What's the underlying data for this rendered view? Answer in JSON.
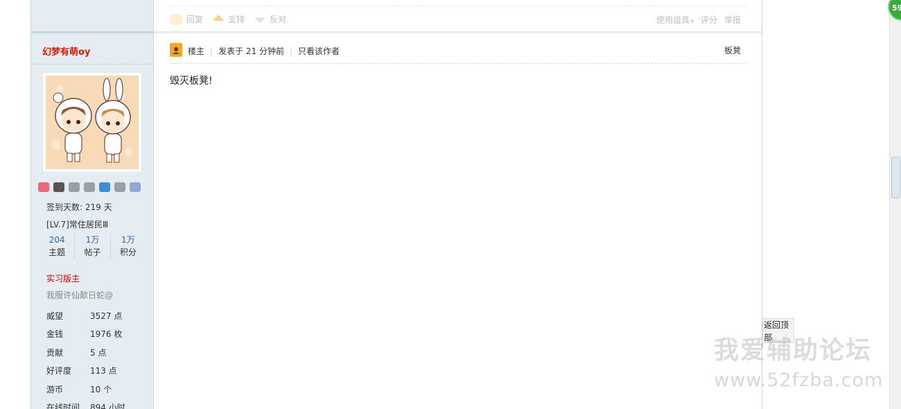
{
  "prev_post": {
    "actions": [
      "回复",
      "支持",
      "反对"
    ],
    "tools_label": "使用道具",
    "rate_label": "评分",
    "report_label": "举报"
  },
  "author": {
    "name": "幻梦有萌oy",
    "signin_days": "签到天数: 219 天",
    "level": "[LV.7]常住居民Ⅲ",
    "counts": [
      {
        "num": "204",
        "label": "主题"
      },
      {
        "num": "1万",
        "label": "帖子"
      },
      {
        "num": "1万",
        "label": "积分"
      }
    ],
    "group": "实习版主",
    "signature": "我服许仙歃日蛇@",
    "props": [
      {
        "k": "威望",
        "v": "3527 点"
      },
      {
        "k": "金钱",
        "v": "1976 枚"
      },
      {
        "k": "贡献",
        "v": "5 点"
      },
      {
        "k": "好评度",
        "v": "113 点"
      },
      {
        "k": "游币",
        "v": "10 个"
      },
      {
        "k": "在线时间",
        "v": "894 小时"
      }
    ],
    "medal_colors": [
      "#e86a7a",
      "#555555",
      "#9aa0a6",
      "#9aa0a6",
      "#3a8fd8",
      "#9aa0a6",
      "#8fa8d8"
    ]
  },
  "post": {
    "role": "楼主",
    "time": "发表于 21 分钟前",
    "only_author": "只看该作者",
    "floor": "板凳",
    "message": "毁灭板凳!"
  },
  "ui": {
    "badge_number": "59",
    "back_to_top": "返回顶部"
  },
  "watermark": {
    "cn": "我爱辅助论坛",
    "url": "www.52fzba.com"
  }
}
